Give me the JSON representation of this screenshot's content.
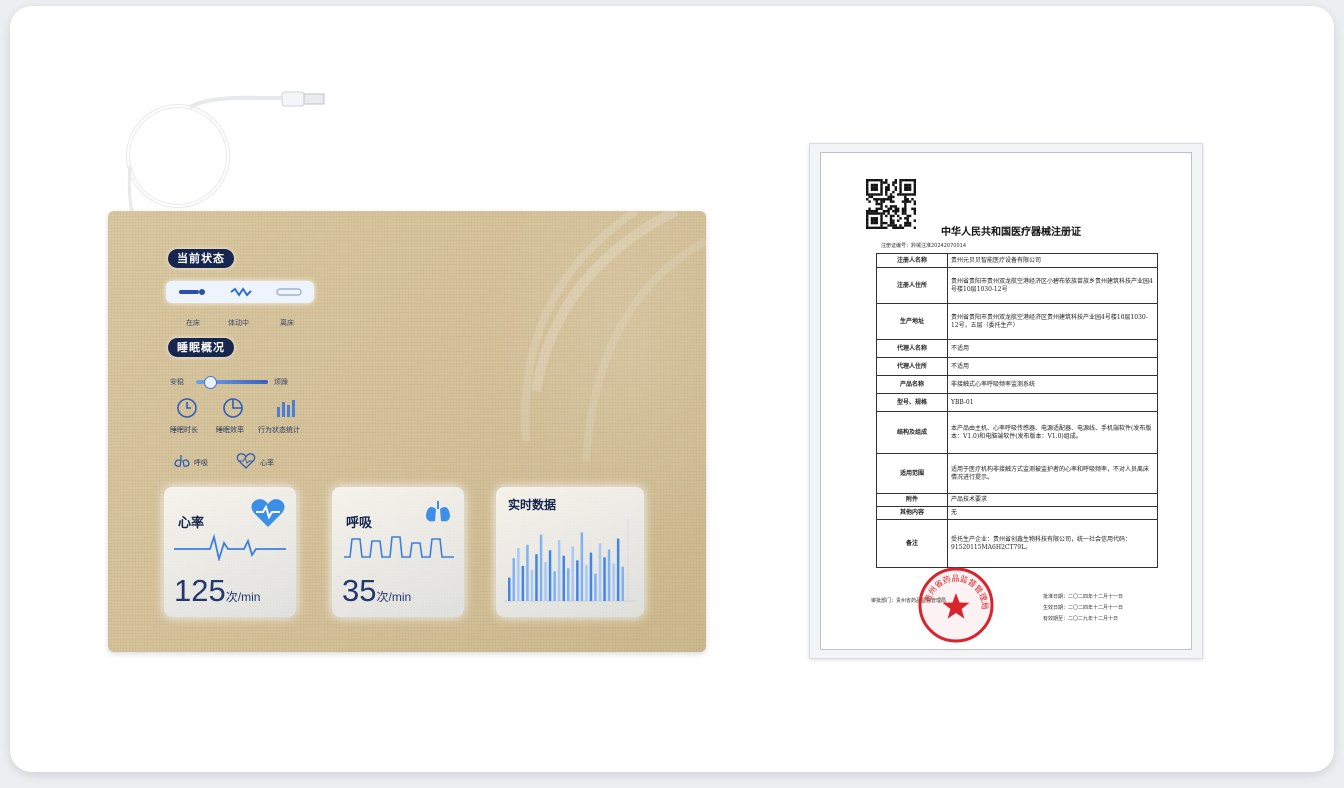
{
  "mat": {
    "status_title": "当前状态",
    "status_labels": [
      "在床",
      "体动中",
      "离床"
    ],
    "sleep_title": "睡眠概况",
    "slider_left": "安稳",
    "slider_right": "烦躁",
    "slider_level": 0.18,
    "metrics": [
      "睡眠时长",
      "睡眠效率",
      "行为状态统计"
    ],
    "legend": [
      "呼吸",
      "心率"
    ],
    "heart": {
      "title": "心率",
      "value": "125",
      "unit": "次/min"
    },
    "breath": {
      "title": "呼吸",
      "value": "35",
      "unit": "次/min"
    },
    "realtime": {
      "title": "实时数据"
    }
  },
  "chart_data": {
    "type": "bar",
    "title": "实时数据",
    "values": [
      30,
      55,
      68,
      45,
      72,
      40,
      60,
      85,
      50,
      65,
      38,
      78,
      58,
      42,
      70,
      52,
      88,
      46,
      62,
      35,
      74,
      56,
      66,
      48,
      80,
      44
    ]
  },
  "certificate": {
    "title": "中华人民共和国医疗器械注册证",
    "number": "注册证编号：黔械注准20242070014",
    "rows": [
      {
        "key": "注册人名称",
        "value": "贵州元贝贝智能医疗设备有限公司"
      },
      {
        "key": "注册人住所",
        "value": "贵州省贵阳市贵州双龙航空港经济区小碧布依族苗族乡贵州建筑科技产业园4号楼10层1030-12号"
      },
      {
        "key": "生产地址",
        "value": "贵州省贵阳市贵州双龙航空港经济区贵州建筑科技产业园4号楼10层1030-12号，五层（委托生产）"
      },
      {
        "key": "代理人名称",
        "value": "不适用"
      },
      {
        "key": "代理人住所",
        "value": "不适用"
      },
      {
        "key": "产品名称",
        "value": "非接触式心率呼吸频率监测系统"
      },
      {
        "key": "型号、规格",
        "value": "YBB-01"
      },
      {
        "key": "结构及组成",
        "value": "本产品由主机、心率呼吸传感器、电源适配器、电源线、手机端软件(发布版本：V1.0)和电脑端软件(发布版本：V1.0)组成。"
      },
      {
        "key": "适用范围",
        "value": "适用于医疗机构非接触方式监测被监护者的心率和呼吸频率，不对人员离床情况进行提示。"
      },
      {
        "key": "附件",
        "value": "产品技术要求"
      },
      {
        "key": "其他内容",
        "value": "无"
      },
      {
        "key": "备注",
        "value": "受托生产企业：贵州省创鑫生物科技有限公司，统一社会信用代码：91520115MA6H2CT79L。"
      }
    ],
    "approval_label": "审批部门：贵州省药品监督管理局",
    "approval_date": "批准日期：二〇二四年十二月十一日",
    "effective_date": "生效日期：二〇二四年十二月十一日",
    "expiry_date": "有效期至：二〇二九年十二月十日",
    "seal_text": "贵州省药品监督管理局"
  }
}
